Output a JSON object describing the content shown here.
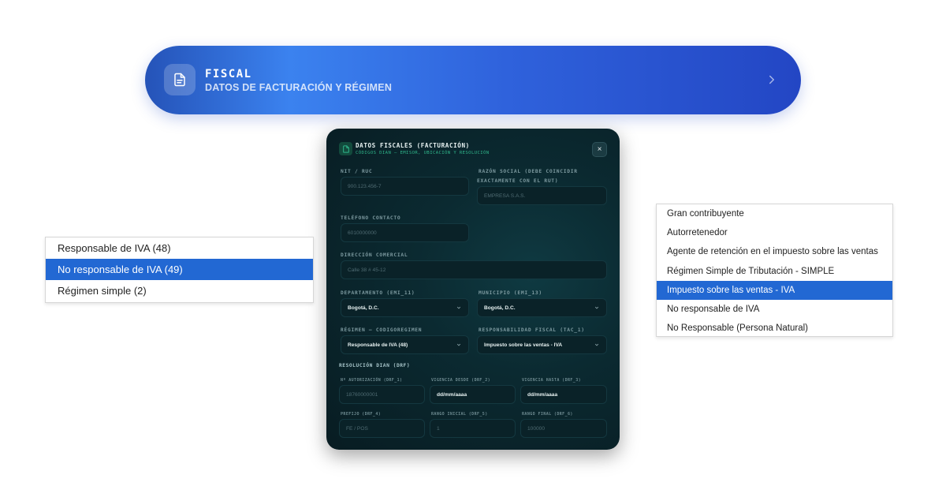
{
  "banner": {
    "title": "FISCAL",
    "subtitle": "DATOS DE FACTURACIÓN Y RÉGIMEN",
    "icon": "document-icon",
    "chevron_icon": "chevron-right-icon"
  },
  "modal": {
    "title": "DATOS FISCALES (FACTURACIÓN)",
    "subtitle": "CÓDIGOS DIAN — EMISOR, UBICACIÓN Y RESOLUCIÓN",
    "close_label": "×",
    "fields": {
      "nit": {
        "label": "NIT / RUC",
        "placeholder": "900.123.456-7"
      },
      "razon": {
        "label_line1": "RAZÓN SOCIAL (DEBE COINCIDIR",
        "label_line2": "EXACTAMENTE CON EL RUT)",
        "placeholder": "EMPRESA S.A.S."
      },
      "telefono": {
        "label": "TELÉFONO CONTACTO",
        "placeholder": "6010000000"
      },
      "direccion": {
        "label": "DIRECCIÓN COMERCIAL",
        "placeholder": "Calle 38 # 45-12"
      },
      "departamento": {
        "label": "DEPARTAMENTO (EMI_11)",
        "value": "Bogotá, D.C."
      },
      "municipio": {
        "label": "MUNICIPIO (EMI_13)",
        "value": "Bogotá, D.C."
      },
      "regimen": {
        "label": "RÉGIMEN — CODIGOREGIMEN",
        "value": "Responsable de IVA (48)"
      },
      "responsabilidad": {
        "label": "RESPONSABILIDAD FISCAL (TAC_1)",
        "value": "Impuesto sobre las ventas - IVA"
      }
    },
    "resolucion": {
      "title": "RESOLUCIÓN DIAN (DRF)",
      "autorizacion": {
        "label": "Nº AUTORIZACIÓN (DRF_1)",
        "placeholder": "18760000001"
      },
      "vigencia_desde": {
        "label": "VIGENCIA DESDE (DRF_2)",
        "value": "dd/mm/aaaa"
      },
      "vigencia_hasta": {
        "label": "VIGENCIA HASTA (DRF_3)",
        "value": "dd/mm/aaaa"
      },
      "prefijo": {
        "label": "PREFIJO (DRF_4)",
        "placeholder": "FE / POS"
      },
      "rango_inicial": {
        "label": "RANGO INICIAL (DRF_5)",
        "placeholder": "1"
      },
      "rango_final": {
        "label": "RANGO FINAL (DRF_6)",
        "placeholder": "100000"
      }
    }
  },
  "regimen_dropdown": {
    "options": [
      "Responsable de IVA (48)",
      "No responsable de IVA (49)",
      "Régimen simple (2)"
    ],
    "highlighted_index": 1
  },
  "responsabilidad_dropdown": {
    "options": [
      "Gran contribuyente",
      "Autorretenedor",
      "Agente de retención en el impuesto sobre las ventas",
      "Régimen Simple de Tributación - SIMPLE",
      "Impuesto sobre las ventas - IVA",
      "No responsable de IVA",
      "No Responsable (Persona Natural)"
    ],
    "highlighted_index": 4
  },
  "colors": {
    "banner_gradient_start": "#2553b8",
    "banner_gradient_mid": "#3b82ef",
    "banner_gradient_end": "#2346c4",
    "modal_background": "#0b2a31",
    "accent_green": "#2fb58a",
    "selection_blue": "#2268d3"
  }
}
